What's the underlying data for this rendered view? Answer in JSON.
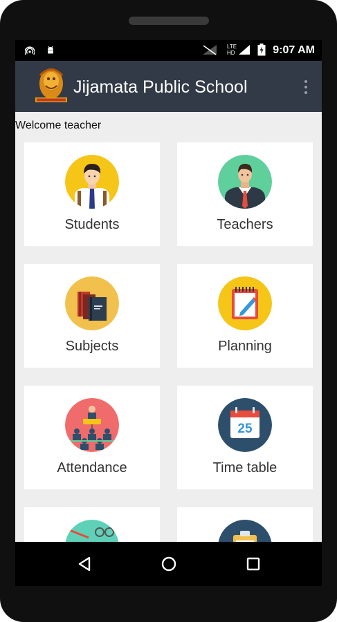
{
  "status_bar": {
    "time": "9:07 AM",
    "network_label": "LTE",
    "network_sub": "HD",
    "icons": [
      "hotspot-icon",
      "android-icon",
      "signal-off-icon",
      "signal-icon",
      "battery-charging-icon"
    ]
  },
  "app_bar": {
    "title": "Jijamata Public School",
    "logo_icon": "school-logo",
    "menu_icon": "overflow-menu-icon"
  },
  "welcome_text": "Welcome teacher",
  "tiles": [
    {
      "label": "Students",
      "icon": "student-icon",
      "color": "#f5c518"
    },
    {
      "label": "Teachers",
      "icon": "teacher-icon",
      "color": "#5fcf9b"
    },
    {
      "label": "Subjects",
      "icon": "books-icon",
      "color": "#f2c04d"
    },
    {
      "label": "Planning",
      "icon": "notepad-icon",
      "color": "#f5c518"
    },
    {
      "label": "Attendance",
      "icon": "classroom-icon",
      "color": "#f06b6b"
    },
    {
      "label": "Time table",
      "icon": "calendar-icon",
      "color": "#2d4f6c",
      "calendar_day": "25"
    },
    {
      "label": "",
      "icon": "homework-icon",
      "color": "#5fd1b9"
    },
    {
      "label": "",
      "icon": "clipboard-icon",
      "color": "#2d4f6c"
    }
  ],
  "nav_bar": {
    "back_icon": "back-triangle-icon",
    "home_icon": "home-circle-icon",
    "recents_icon": "recents-square-icon"
  },
  "colors": {
    "app_bar": "#323a47",
    "content_bg": "#eeeeee",
    "tile_bg": "#ffffff"
  }
}
